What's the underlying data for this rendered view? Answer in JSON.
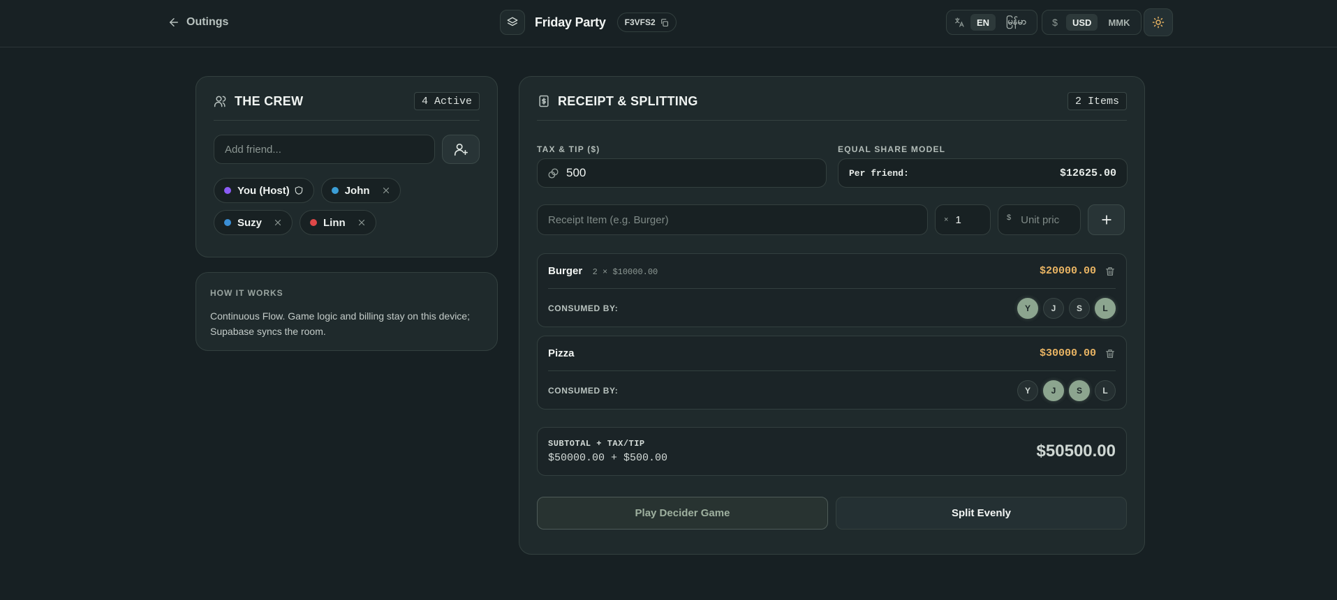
{
  "header": {
    "back_label": "Outings",
    "room_title": "Friday Party",
    "room_code": "F3VFS2",
    "languages": [
      "EN",
      "မြန်မာ"
    ],
    "active_language": "EN",
    "currencies": [
      "USD",
      "MMK"
    ],
    "active_currency": "USD",
    "currency_symbol": "$"
  },
  "crew": {
    "title": "THE CREW",
    "badge": "4 Active",
    "add_placeholder": "Add friend...",
    "members": [
      {
        "name": "You (Host)",
        "color": "#8b5cf6",
        "host": true
      },
      {
        "name": "John",
        "color": "#3b9ed6",
        "host": false
      },
      {
        "name": "Suzy",
        "color": "#3b8fd6",
        "host": false
      },
      {
        "name": "Linn",
        "color": "#e04848",
        "host": false
      }
    ]
  },
  "how": {
    "title": "HOW IT WORKS",
    "text": "Continuous Flow. Game logic and billing stay on this device; Supabase syncs the room."
  },
  "receipt": {
    "title": "RECEIPT & SPLITTING",
    "badge": "2 Items",
    "tax_label": "TAX & TIP ($)",
    "tax_value": "500",
    "share_label": "EQUAL SHARE MODEL",
    "per_friend_label": "Per friend:",
    "per_friend_value": "$12625.00",
    "item_placeholder": "Receipt Item (e.g. Burger)",
    "qty_prefix": "×",
    "qty_value": "1",
    "price_prefix": "$",
    "price_placeholder": "Unit price",
    "consumed_label": "CONSUMED BY:",
    "items": [
      {
        "name": "Burger",
        "meta": "2 × $10000.00",
        "total": "$20000.00",
        "consumers": [
          {
            "initial": "Y",
            "on": true
          },
          {
            "initial": "J",
            "on": false
          },
          {
            "initial": "S",
            "on": false
          },
          {
            "initial": "L",
            "on": true
          }
        ]
      },
      {
        "name": "Pizza",
        "meta": "",
        "total": "$30000.00",
        "consumers": [
          {
            "initial": "Y",
            "on": false
          },
          {
            "initial": "J",
            "on": true
          },
          {
            "initial": "S",
            "on": true
          },
          {
            "initial": "L",
            "on": false
          }
        ]
      }
    ],
    "summary_label": "SUBTOTAL + TAX/TIP",
    "summary_calc": "$50000.00 + $500.00",
    "summary_total": "$50500.00"
  },
  "actions": {
    "game_label": "Play Decider Game",
    "split_label": "Split Evenly"
  },
  "colors": {
    "accent_amber": "#e9b463",
    "selected_green": "#8ca58f",
    "background": "#172023"
  }
}
